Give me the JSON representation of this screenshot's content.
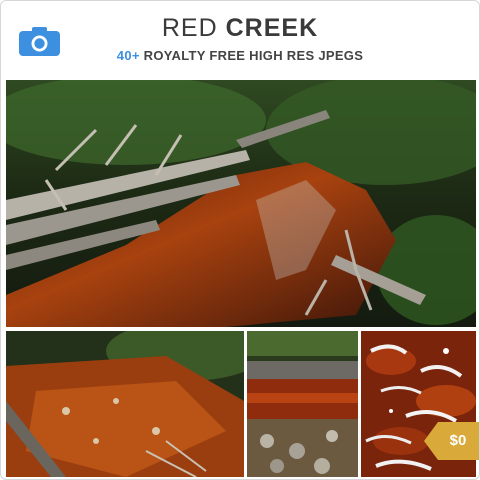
{
  "header": {
    "title_light": "RED",
    "title_bold": "CREEK",
    "subtitle_count": "40+",
    "subtitle_rest": "ROYALTY FREE HIGH RES JPEGS"
  },
  "icons": {
    "logo": "camera-icon"
  },
  "colors": {
    "accent_blue": "#3d8fe0",
    "price_gold": "#d9a93a",
    "water_red": "#8a2c10"
  },
  "images": {
    "main": "red creek with fallen logs in rainforest",
    "thumb1": "rust-colored creek bed with rocks",
    "thumb2": "clear red water over pebbles",
    "thumb3": "close-up of red water ripples with white highlights"
  },
  "badge": {
    "price": "$0"
  }
}
